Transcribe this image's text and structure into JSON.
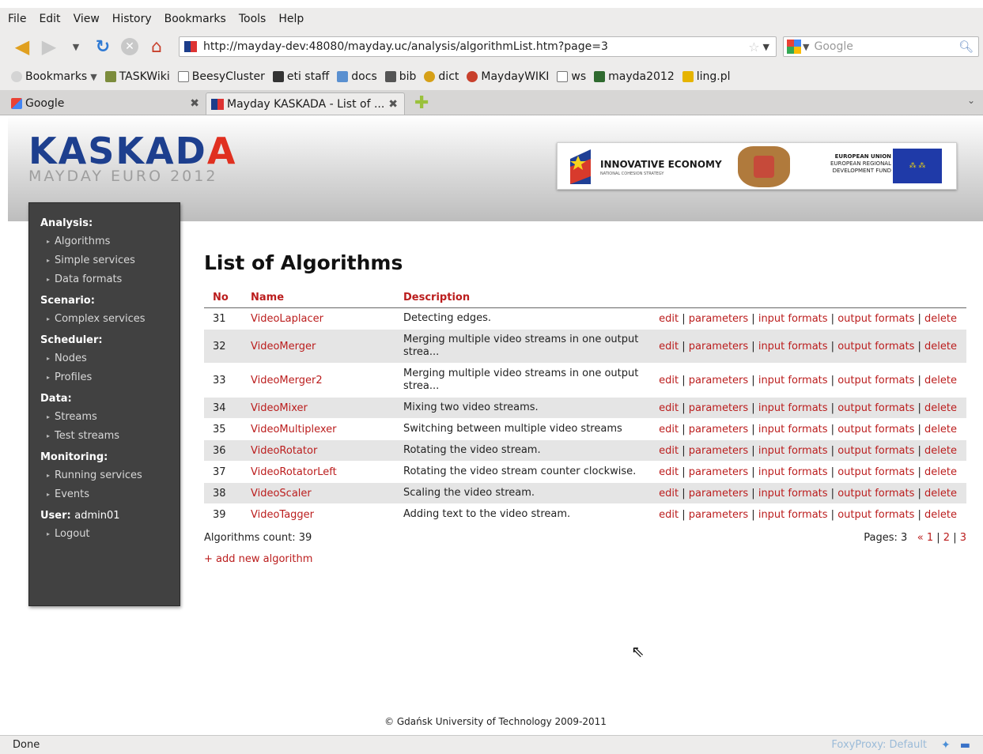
{
  "menu": [
    "File",
    "Edit",
    "View",
    "History",
    "Bookmarks",
    "Tools",
    "Help"
  ],
  "url": "http://mayday-dev:48080/mayday.uc/analysis/algorithmList.htm?page=3",
  "search_placeholder": "Google",
  "bookmarks": [
    {
      "label": "Bookmarks",
      "icon": "bookmarks-icon"
    },
    {
      "label": "TASKWiki",
      "icon": "wiki-icon"
    },
    {
      "label": "BeesyCluster",
      "icon": "cluster-icon"
    },
    {
      "label": "eti staff",
      "icon": "staff-icon"
    },
    {
      "label": "docs",
      "icon": "docs-icon"
    },
    {
      "label": "bib",
      "icon": "bib-icon"
    },
    {
      "label": "dict",
      "icon": "dict-icon"
    },
    {
      "label": "MaydayWIKI",
      "icon": "maydaywiki-icon"
    },
    {
      "label": "ws",
      "icon": "ws-icon"
    },
    {
      "label": "mayda2012",
      "icon": "mayda-icon"
    },
    {
      "label": "ling.pl",
      "icon": "ling-icon"
    }
  ],
  "tabs": [
    {
      "label": "Google"
    },
    {
      "label": "Mayday KASKADA - List of ..."
    }
  ],
  "header": {
    "logo": "KASKADA",
    "logo_sub": "MAYDAY EURO 2012",
    "ie_title": "INNOVATIVE ECONOMY",
    "ie_sub": "NATIONAL COHESION STRATEGY",
    "eu_line1": "EUROPEAN UNION",
    "eu_line2": "EUROPEAN REGIONAL",
    "eu_line3": "DEVELOPMENT FUND"
  },
  "sidebar": {
    "sections": [
      {
        "title": "Analysis:",
        "items": [
          "Algorithms",
          "Simple services",
          "Data formats"
        ]
      },
      {
        "title": "Scenario:",
        "items": [
          "Complex services"
        ]
      },
      {
        "title": "Scheduler:",
        "items": [
          "Nodes",
          "Profiles"
        ]
      },
      {
        "title": "Data:",
        "items": [
          "Streams",
          "Test streams"
        ]
      },
      {
        "title": "Monitoring:",
        "items": [
          "Running services",
          "Events"
        ]
      }
    ],
    "user_label": "User:",
    "user_name": "admin01",
    "logout": "Logout"
  },
  "main": {
    "title": "List of Algorithms",
    "columns": [
      "No",
      "Name",
      "Description"
    ],
    "actions": [
      "edit",
      "parameters",
      "input formats",
      "output formats",
      "delete"
    ],
    "rows": [
      {
        "no": "31",
        "name": "VideoLaplacer",
        "desc": "Detecting edges."
      },
      {
        "no": "32",
        "name": "VideoMerger",
        "desc": "Merging multiple video streams in one output strea..."
      },
      {
        "no": "33",
        "name": "VideoMerger2",
        "desc": "Merging multiple video streams in one output strea..."
      },
      {
        "no": "34",
        "name": "VideoMixer",
        "desc": "Mixing two video streams."
      },
      {
        "no": "35",
        "name": "VideoMultiplexer",
        "desc": "Switching between multiple video streams"
      },
      {
        "no": "36",
        "name": "VideoRotator",
        "desc": "Rotating the video stream."
      },
      {
        "no": "37",
        "name": "VideoRotatorLeft",
        "desc": "Rotating the video stream counter clockwise."
      },
      {
        "no": "38",
        "name": "VideoScaler",
        "desc": "Scaling the video stream."
      },
      {
        "no": "39",
        "name": "VideoTagger",
        "desc": "Adding text to the video stream."
      }
    ],
    "count_label": "Algorithms count: 39",
    "pages_label": "Pages: 3",
    "pages_prev": "«",
    "pages": [
      "1",
      "2",
      "3"
    ],
    "add_link": "+ add new algorithm"
  },
  "copyright": "© Gdańsk University of Technology 2009-2011",
  "status": {
    "left": "Done",
    "foxyproxy": "FoxyProxy: Default"
  }
}
